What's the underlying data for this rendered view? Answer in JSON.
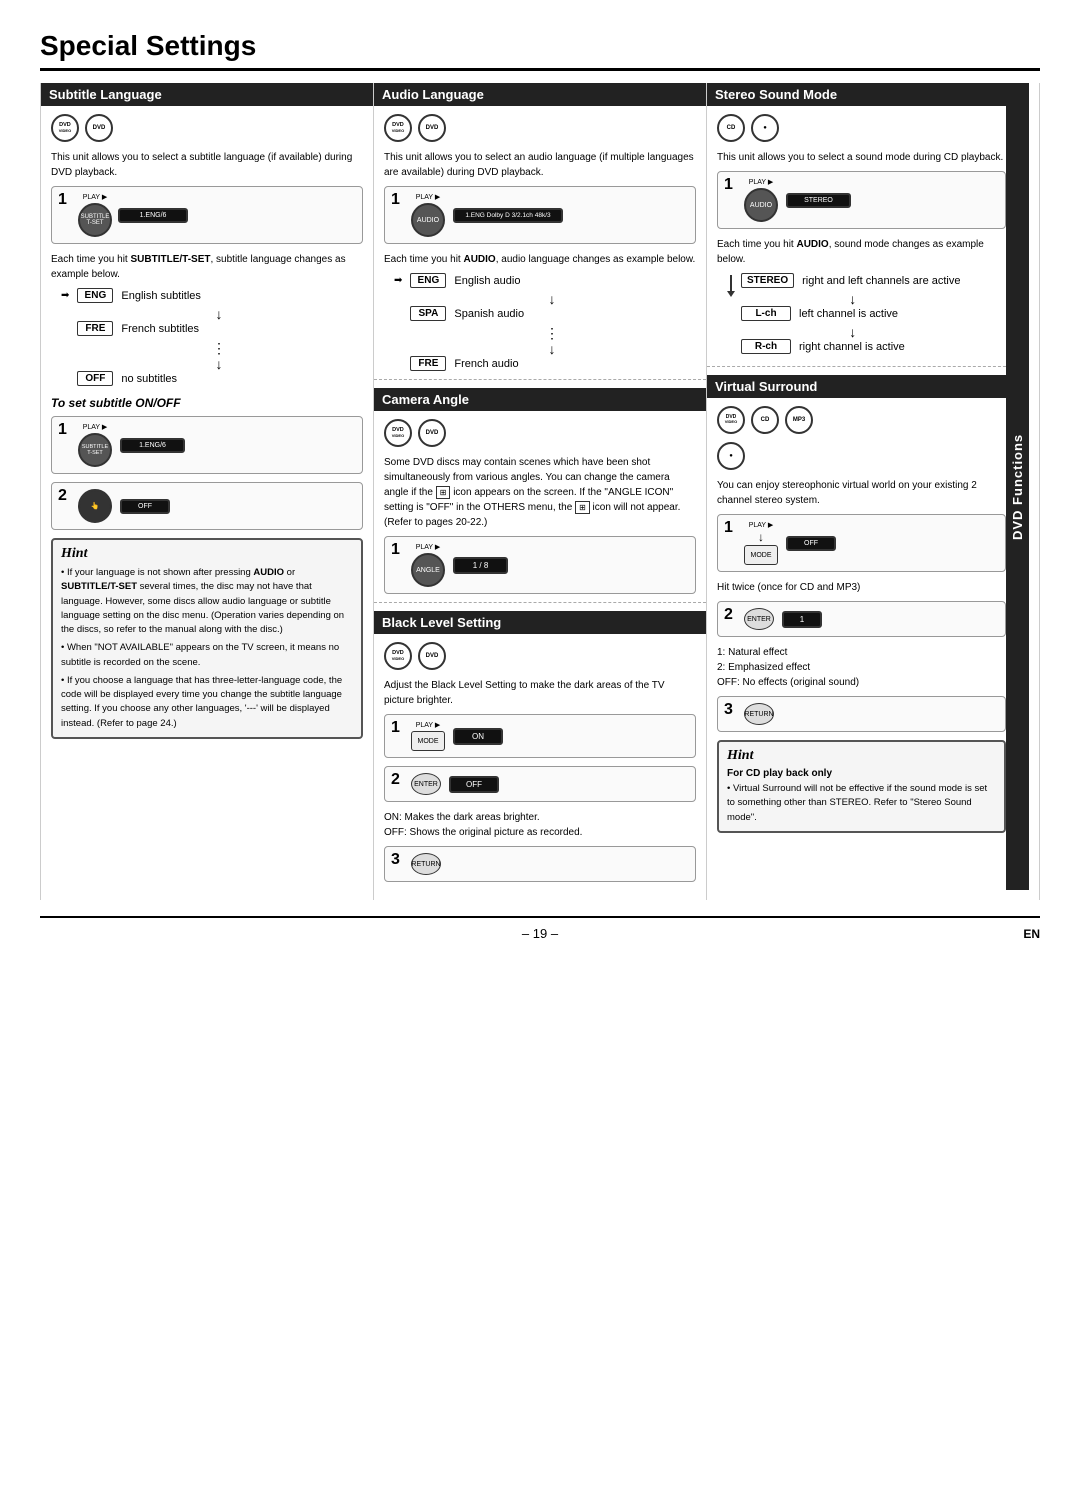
{
  "page": {
    "title": "Special Settings",
    "footer_page": "– 19 –",
    "footer_en": "EN"
  },
  "subtitle_language": {
    "header": "Subtitle Language",
    "body": "This unit allows you to select a subtitle language (if available) during DVD playback.",
    "step1_screen": "1.ENG/6",
    "each_time_text": "Each time you hit SUBTITLE/T-SET, subtitle language changes as example below.",
    "langs": [
      {
        "tag": "ENG",
        "desc": "English subtitles"
      },
      {
        "tag": "FRE",
        "desc": "French subtitles"
      },
      {
        "tag": "OFF",
        "desc": "no subtitles"
      }
    ],
    "sub_section_title": "To set subtitle ON/OFF",
    "step1b_screen": "1.ENG/6",
    "step2b_screen": "OFF"
  },
  "hint": {
    "title": "Hint",
    "items": [
      "If your language is not shown after pressing AUDIO or SUBTITLE/T-SET several times, the disc may not have that language. However, some discs allow audio language or subtitle language setting on the disc menu. (Operation varies depending on the discs, so refer to the manual along with the disc.)",
      "When \"NOT AVAILABLE\" appears on the TV screen, it means no subtitle is recorded on the scene.",
      "If you choose a language that has three-letter-language code, the code will be displayed every time you change the subtitle language setting. If you choose any other languages, '---' will be displayed instead. (Refer to page 24.)"
    ]
  },
  "audio_language": {
    "header": "Audio Language",
    "body": "This unit allows you to select an audio language (if multiple languages are available) during DVD playback.",
    "step1_screen": "1.ENG Dolby D 3/2.1ch 48k/3",
    "each_time_text": "Each time you hit AUDIO, audio language changes as example below.",
    "langs": [
      {
        "tag": "ENG",
        "desc": "English audio"
      },
      {
        "tag": "SPA",
        "desc": "Spanish audio"
      },
      {
        "tag": "FRE",
        "desc": "French audio"
      }
    ]
  },
  "camera_angle": {
    "header": "Camera Angle",
    "body": "Some DVD discs may contain scenes which have been shot simultaneously from various angles. You can change the camera angle if the icon appears on the screen. If the \"ANGLE ICON\" setting is \"OFF\" in the OTHERS menu, the icon will not appear. (Refer to pages 20-22.)",
    "step1_screen": "1 / 8"
  },
  "black_level": {
    "header": "Black Level Setting",
    "body": "Adjust the Black Level Setting to make the dark areas of the TV picture brighter.",
    "step1_screen": "ON",
    "step2_screen": "OFF",
    "note1": "ON: Makes the dark areas brighter.",
    "note2": "OFF: Shows the original picture as recorded."
  },
  "stereo_sound": {
    "header": "Stereo Sound Mode",
    "body": "This unit allows you to select a sound mode during CD playback.",
    "step1_screen": "STEREO",
    "each_time_text": "Each time you hit AUDIO, sound mode changes as example below.",
    "modes": [
      {
        "tag": "STEREO",
        "desc": "right and left channels are active"
      },
      {
        "tag": "L-ch",
        "desc": "left channel is active"
      },
      {
        "tag": "R-ch",
        "desc": "right channel is active"
      }
    ]
  },
  "virtual_surround": {
    "header": "Virtual Surround",
    "body": "You can enjoy stereophonic virtual world on your existing 2 channel stereo system.",
    "step1_screen": "OFF",
    "hit_twice_text": "Hit twice (once for CD and MP3)",
    "step2_screen": "1",
    "effects": [
      "1: Natural effect",
      "2: Emphasized effect",
      "OFF: No effects (original sound)"
    ],
    "dvd_functions_label": "DVD Functions"
  },
  "hint2": {
    "title": "Hint",
    "subtitle": "For CD play back only",
    "items": [
      "Virtual Surround will not be effective if the sound mode is set to something other than STEREO. Refer to \"Stereo Sound mode\"."
    ]
  }
}
